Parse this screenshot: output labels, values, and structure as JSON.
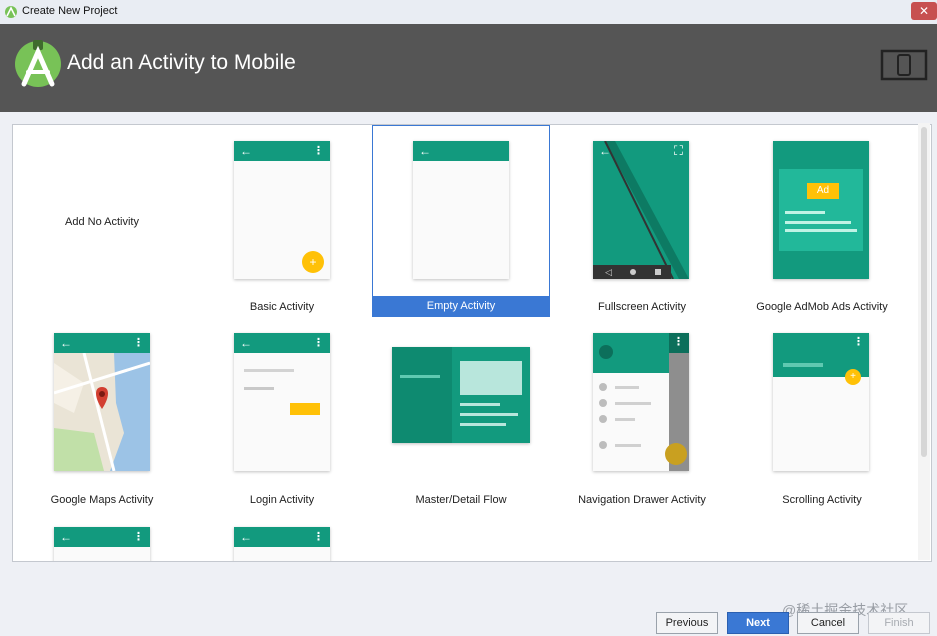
{
  "window": {
    "title": "Create New Project",
    "close_glyph": "✕"
  },
  "header": {
    "heading": "Add an Activity to Mobile",
    "logo_icon": "android-studio-logo-icon",
    "device_icon": "phone-tablet-device-icon"
  },
  "gallery": {
    "selected": "Empty Activity",
    "tiles": [
      {
        "label": "Add No Activity"
      },
      {
        "label": "Basic Activity"
      },
      {
        "label": "Empty Activity"
      },
      {
        "label": "Fullscreen Activity"
      },
      {
        "label": "Google AdMob Ads Activity",
        "ad_badge": "Ad"
      },
      {
        "label": "Google Maps Activity"
      },
      {
        "label": "Login Activity"
      },
      {
        "label": "Master/Detail Flow"
      },
      {
        "label": "Navigation Drawer Activity"
      },
      {
        "label": "Scrolling Activity"
      }
    ]
  },
  "icons": {
    "back_arrow": "←",
    "overflow_menu": "⋮",
    "fab_plus": "+",
    "fullscreen": "⛶"
  },
  "buttons": {
    "previous": "Previous",
    "next": "Next",
    "cancel": "Cancel",
    "finish": "Finish"
  },
  "watermark": "@稀土掘金技术社区",
  "colors": {
    "accent": "#3a78d4",
    "teal": "#129a7e",
    "header": "#555555",
    "fab": "#ffc107"
  }
}
